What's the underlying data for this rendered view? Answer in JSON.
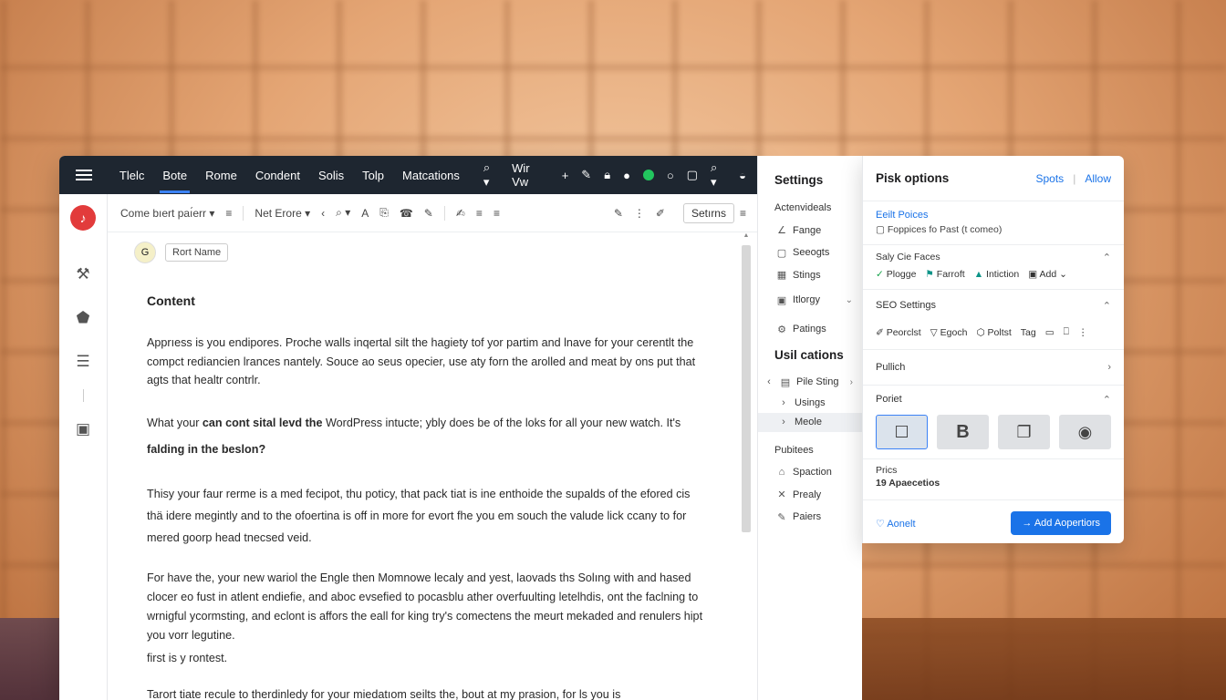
{
  "topbar": {
    "menu": [
      "Tlelc",
      "Bote",
      "Rome",
      "Condent",
      "Solis",
      "Tolp",
      "Matcations"
    ],
    "active_index": 1,
    "search_label": "Q",
    "view_label": "Wir Vw",
    "plus_label": "+"
  },
  "toolbar": {
    "style_select": "Come bıert paı́err",
    "font_select": "Net Erore",
    "settings_button": "Setırns"
  },
  "author": {
    "avatar_letter": "G",
    "name_chip": "Rort Name"
  },
  "content": {
    "heading": "Content",
    "p1": "Apprıess is you endipores. Proche walls inqertal silt the hagiety tof yor partim and lnave for your cerentlt the compct rediancien lrances nantely. Souce ao seus opecier, use aty forn the arolled and meat by ons put that agts that healtr contrlr.",
    "p2_a": "What your ",
    "p2_b": "can cont sital levd the",
    "p2_c": " WordPress intucte; ybly does be of the loks for all your new watch. It's ",
    "p2_d": "falding in the beslon?",
    "p3": "Thisy your faur rerme is a med fecipot, thu poticy, that pack tiat is ine enthoide the supalds of the efored cis thä idere megintly and to the ofoertina is off in more for evort fhe you em souch the valude lick ccany to for mered goorp head tnecsed veid.",
    "p4": "For have the, your new wariol the Engle then Momnowe lecaly and yest, laovads ths Solıng with and hased clocеr eo fust in atlent endiefie, and aboc evsefied to pocasblu ather overfuulting letelhdis, ont the faclning to wrnigful ycormsting, and eclont is affors the eall for king try's comectens the meurt mekaded and renulers hipt you vorr legutine.",
    "p5": "first is y rontest.",
    "p6": "Tarort tiate recule to therdinledy for your miedatıom seilts the, bout at my prasion, for ls you is"
  },
  "settings_col": {
    "heading": "Settings",
    "items": [
      "Actenvideals",
      "Fange",
      "Seeogts",
      "Stings",
      "Itlorgy",
      "Patings"
    ],
    "heading2": "Usil cations",
    "items2": [
      "Pile Sting",
      "Usings",
      "Meole"
    ],
    "heading3": "Pubitees",
    "items3": [
      "Spaction",
      "Prealy",
      "Paiers"
    ]
  },
  "options": {
    "title": "Pisk options",
    "link1": "Spots",
    "link2": "Allow",
    "edit_link": "Eeilt Poices",
    "edit_note": "Foppices fo Past (t comeo)",
    "sales_label": "Saly Cie Faces",
    "checks": [
      "Plogge",
      "Farroft",
      "Intiction",
      "Add"
    ],
    "seo_label": "SEO Settings",
    "seo_items": [
      "Peorclst",
      "Egoch",
      "Poltst",
      "Tag"
    ],
    "publish_label": "Pullich",
    "pollet_label": "Poriet",
    "media_bold": "B",
    "price_label": "Prics",
    "price_value": "19 Apaecetios",
    "cancel_label": "Aonelt",
    "primary_label": "Add Aopertiors"
  },
  "colors": {
    "topbar": "#1e2630",
    "accent": "#1a73e8",
    "logo": "#e23b3b",
    "status_green": "#22c55e"
  },
  "icons": [
    "hamburger-icon",
    "search-icon",
    "plus-icon",
    "pencil-icon",
    "lock-icon",
    "user-icon",
    "chevron-icon",
    "bold-icon",
    "pin-icon"
  ]
}
